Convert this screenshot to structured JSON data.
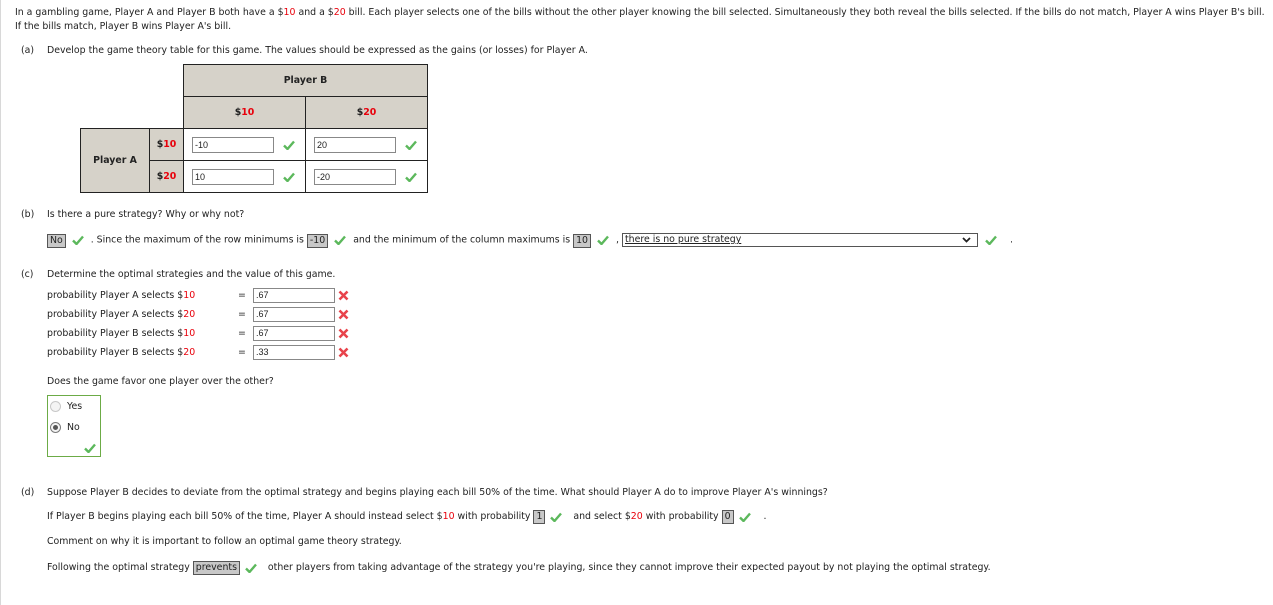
{
  "intro": {
    "text_1": "In a gambling game, Player A and Player B both have a ",
    "bill_10_dollar": "$",
    "bill_10_num": "10",
    "text_2": " and a ",
    "bill_20_dollar": "$",
    "bill_20_num": "20",
    "text_3": " bill. Each player selects one of the bills without the other player knowing the bill selected. Simultaneously they both reveal the bills selected. If the bills do not match, Player A wins Player B's bill. If the bills match, Player B wins Player A's bill."
  },
  "part_a": {
    "label": "(a)",
    "question": "Develop the game theory table for this game. The values should be expressed as the gains (or losses) for Player A.",
    "table": {
      "col_player": "Player B",
      "row_player": "Player A",
      "col_headers": [
        {
          "dollar": "$",
          "num": "10"
        },
        {
          "dollar": "$",
          "num": "20"
        }
      ],
      "row_headers": [
        {
          "dollar": "$",
          "num": "10"
        },
        {
          "dollar": "$",
          "num": "20"
        }
      ],
      "cells": [
        [
          {
            "value": "-10",
            "status": "correct"
          },
          {
            "value": "20",
            "status": "correct"
          }
        ],
        [
          {
            "value": "10",
            "status": "correct"
          },
          {
            "value": "-20",
            "status": "correct"
          }
        ]
      ]
    }
  },
  "part_b": {
    "label": "(b)",
    "question": "Is there a pure strategy? Why or why not?",
    "answer_1": "No",
    "text_1": ". Since the maximum of the row minimums is",
    "answer_2": "-10",
    "text_2": "and the minimum of the column maximums is",
    "answer_3": "10",
    "text_3": ",",
    "dropdown_value": "there is no pure strategy",
    "text_end": "."
  },
  "part_c": {
    "label": "(c)",
    "question": "Determine the optimal strategies and the value of this game.",
    "rows": [
      {
        "label_prefix": "probability Player A selects ",
        "dollar": "$",
        "num": "10",
        "eq": "=",
        "value": ".67",
        "status": "incorrect"
      },
      {
        "label_prefix": "probability Player A selects ",
        "dollar": "$",
        "num": "20",
        "eq": "=",
        "value": ".67",
        "status": "incorrect"
      },
      {
        "label_prefix": "probability Player B selects ",
        "dollar": "$",
        "num": "10",
        "eq": "=",
        "value": ".67",
        "status": "incorrect"
      },
      {
        "label_prefix": "probability Player B selects ",
        "dollar": "$",
        "num": "20",
        "eq": "=",
        "value": ".33",
        "status": "incorrect"
      }
    ],
    "favor_question": "Does the game favor one player over the other?",
    "options": [
      {
        "label": "Yes",
        "selected": false
      },
      {
        "label": "No",
        "selected": true
      }
    ]
  },
  "part_d": {
    "label": "(d)",
    "question": "Suppose Player B decides to deviate from the optimal strategy and begins playing each bill 50% of the time. What should Player A do to improve Player A's winnings?",
    "line_1_text_a": "If Player B begins playing each bill 50% of the time, Player A should instead select ",
    "line_1_dollar_a": "$",
    "line_1_num_a": "10",
    "line_1_text_b": " with probability",
    "answer_1": "1",
    "line_1_text_c": "and select ",
    "line_1_dollar_b": "$",
    "line_1_num_b": "20",
    "line_1_text_d": " with probability",
    "answer_2": "0",
    "line_1_end": ".",
    "comment_prompt": "Comment on why it is important to follow an optimal game theory strategy.",
    "line_2_text_a": "Following the optimal strategy",
    "answer_3": "prevents",
    "line_2_text_b": "other players from taking advantage of the strategy you're playing, since they cannot improve their expected payout by not playing the optimal strategy."
  },
  "colors": {
    "accent_red": "#e8000b",
    "header_bg": "#d6d2c9",
    "correct_green": "#5cb85c",
    "incorrect_red": "#e8434b"
  }
}
